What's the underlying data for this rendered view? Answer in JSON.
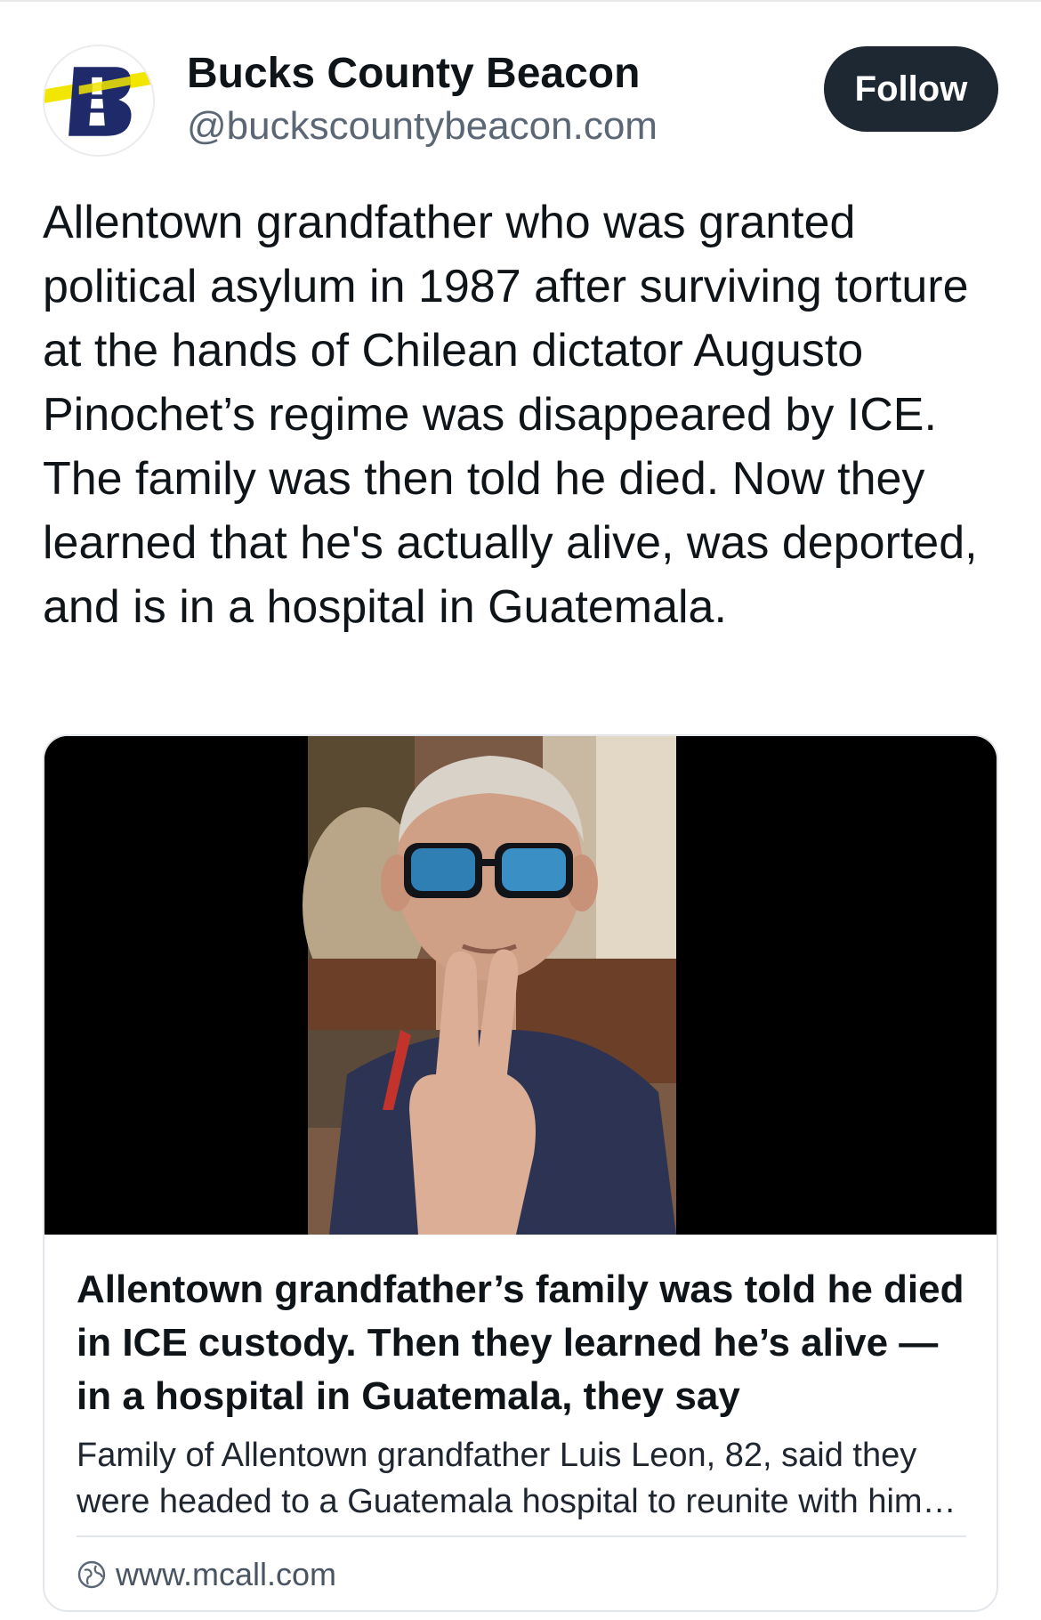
{
  "post": {
    "author": {
      "display_name": "Bucks County Beacon",
      "handle": "@buckscountybeacon.com",
      "avatar_icon": "lighthouse-b-logo-icon",
      "avatar_letter": "B"
    },
    "follow_label": "Follow",
    "text": "Allentown grandfather who was granted political asylum in 1987 after surviving torture at the hands of Chilean dictator Augusto Pinochet’s regime was disappeared by ICE. The family was then told he died. Now they learned that he's actually alive, was deported, and is in a hospital in Guatemala.",
    "link_card": {
      "image_icon": "news-photo-elderly-man-sunglasses",
      "title": "Allentown grandfather’s family was told he died in ICE custody. Then they learned he’s alive — in a hospital in Guatemala, they say",
      "description": "Family of Allentown grandfather Luis Leon, 82, said they were headed to a Guatemala hospital to reunite with him after being told he had died in ICE custody.",
      "domain": "www.mcall.com",
      "domain_icon": "globe-icon"
    }
  },
  "colors": {
    "follow_bg": "#1e2833",
    "text": "#0f1419",
    "muted": "#5b6775",
    "logo_navy": "#1f2a6b",
    "logo_yellow": "#f2e600"
  }
}
